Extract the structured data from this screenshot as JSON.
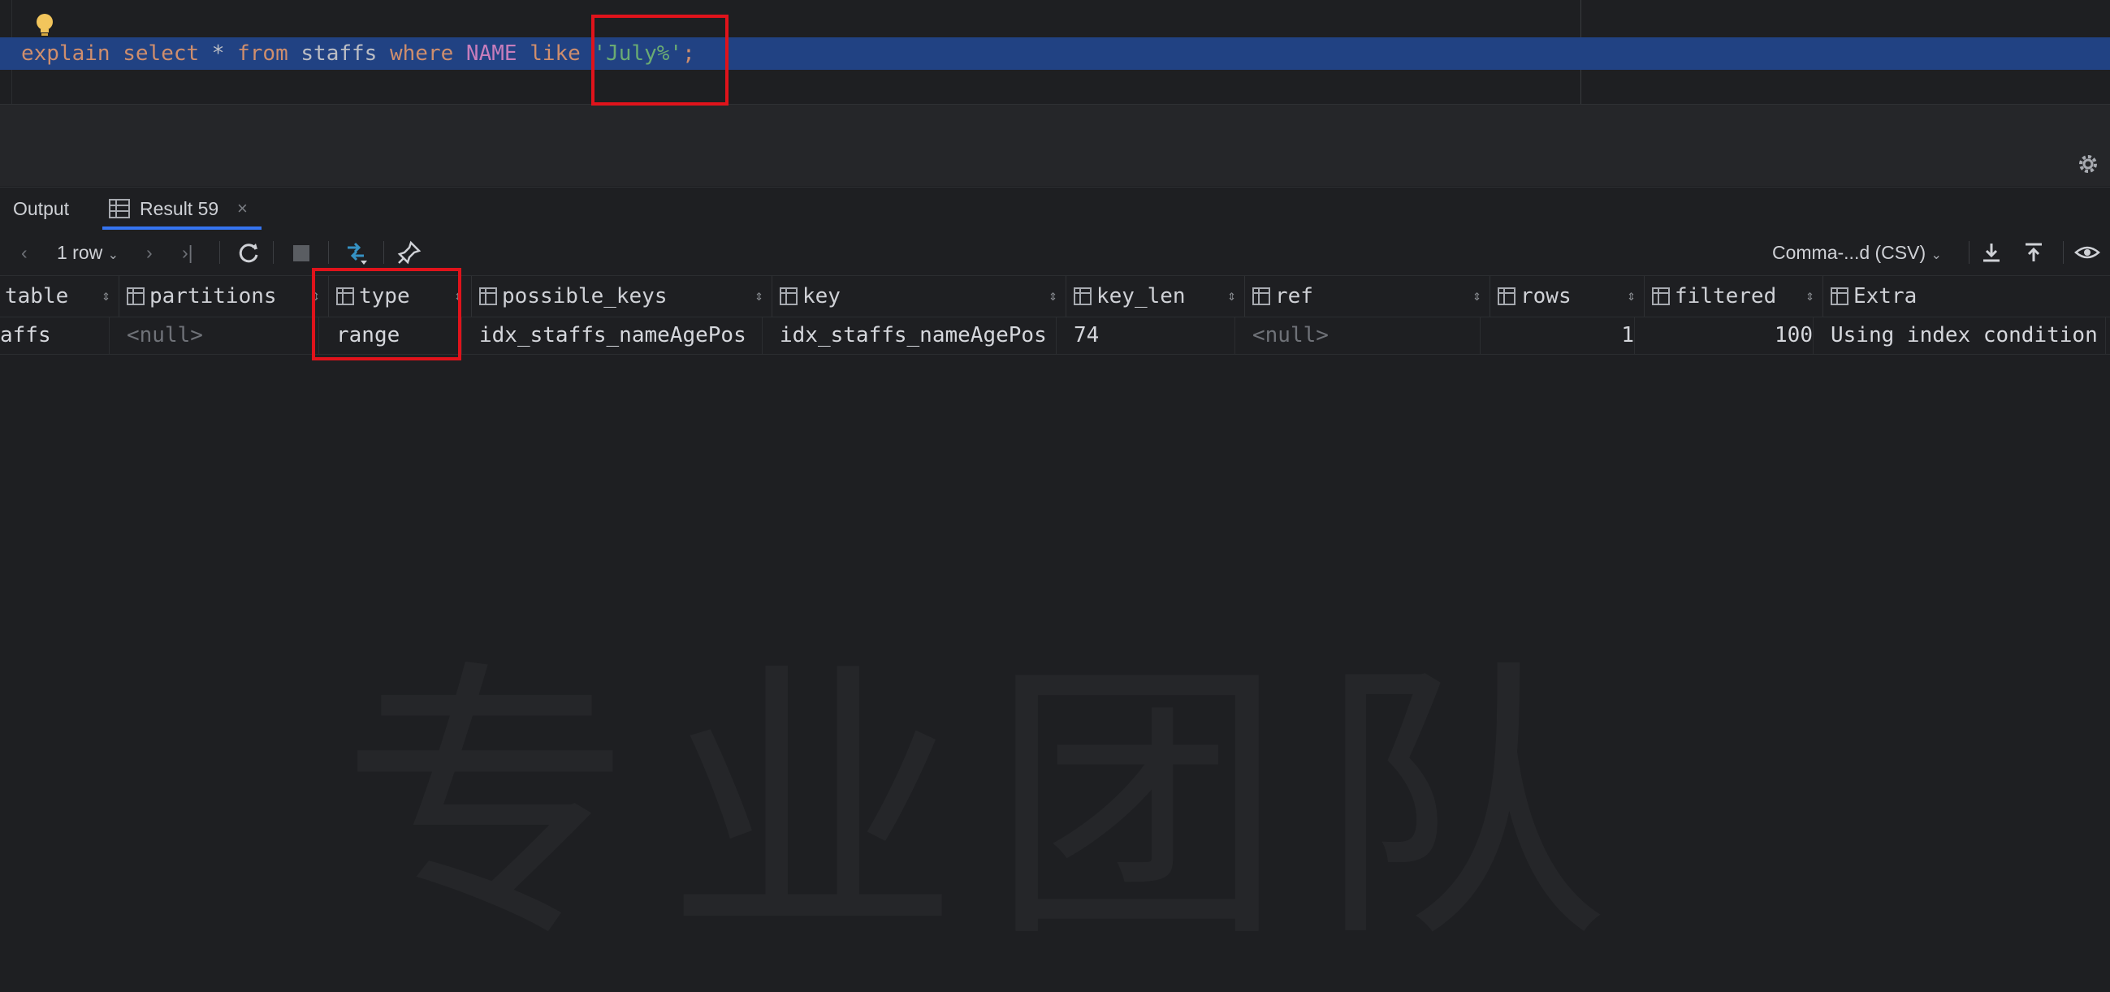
{
  "editor": {
    "code_tokens": [
      {
        "text": "explain",
        "cls": "kw"
      },
      {
        "text": " ",
        "cls": ""
      },
      {
        "text": "select",
        "cls": "kw"
      },
      {
        "text": " * ",
        "cls": ""
      },
      {
        "text": "from",
        "cls": "kw"
      },
      {
        "text": " staffs ",
        "cls": ""
      },
      {
        "text": "where",
        "cls": "kw"
      },
      {
        "text": " ",
        "cls": ""
      },
      {
        "text": "NAME",
        "cls": "col"
      },
      {
        "text": " ",
        "cls": ""
      },
      {
        "text": "like",
        "cls": "kw"
      },
      {
        "text": " ",
        "cls": ""
      },
      {
        "text": "'July%'",
        "cls": "str"
      },
      {
        "text": ";",
        "cls": "kw"
      }
    ]
  },
  "tabs": {
    "output_label": "Output",
    "result_label": "Result 59",
    "close_glyph": "×"
  },
  "toolbar": {
    "row_count": "1 row",
    "export_format": "Comma-...d (CSV)"
  },
  "table": {
    "columns": [
      "table",
      "partitions",
      "type",
      "possible_keys",
      "key",
      "key_len",
      "ref",
      "rows",
      "filtered",
      "Extra"
    ],
    "row": {
      "table": "affs",
      "partitions": "<null>",
      "type": "range",
      "possible_keys": "idx_staffs_nameAgePos",
      "key": "idx_staffs_nameAgePos",
      "key_len": "74",
      "ref": "<null>",
      "rows": "1",
      "filtered": "100",
      "extra": "Using index condition"
    }
  },
  "colors": {
    "accent": "#3574f0",
    "selection": "#214283",
    "keyword": "#cf8e6d",
    "string": "#6aab73",
    "highlight_box": "#e0131b"
  },
  "icons": [
    "lightbulb-icon",
    "gear-icon",
    "output-icon",
    "table-icon",
    "prev-icon",
    "next-icon",
    "last-icon",
    "refresh-icon",
    "stop-icon",
    "compare-icon",
    "pin-icon",
    "download-icon",
    "upload-icon",
    "eye-icon"
  ]
}
